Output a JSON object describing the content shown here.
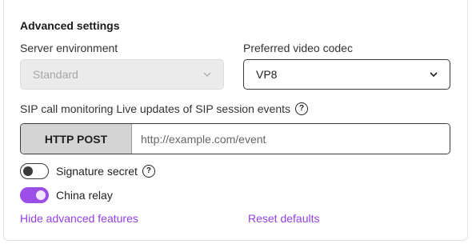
{
  "section": {
    "title": "Advanced settings"
  },
  "server_environment": {
    "label": "Server environment",
    "value": "Standard",
    "disabled": true
  },
  "video_codec": {
    "label": "Preferred video codec",
    "value": "VP8"
  },
  "sip_monitoring": {
    "label": "SIP call monitoring Live updates of SIP session events",
    "help_icon": "question-circle-icon",
    "method": "HTTP POST",
    "url_placeholder": "http://example.com/event",
    "url_value": ""
  },
  "signature_secret": {
    "label": "Signature secret",
    "enabled": false,
    "help_icon": "question-circle-icon"
  },
  "china_relay": {
    "label": "China relay",
    "enabled": true
  },
  "actions": {
    "hide_label": "Hide advanced features",
    "reset_label": "Reset defaults"
  },
  "colors": {
    "accent": "#9b4ee8",
    "link": "#9340e6"
  }
}
